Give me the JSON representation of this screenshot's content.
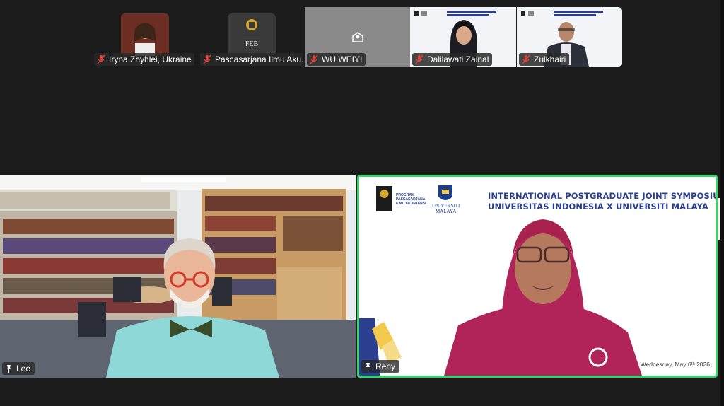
{
  "participants_strip": [
    {
      "name": "Iryna Zhyhlei, Ukraine",
      "muted": true,
      "avatar": "photo"
    },
    {
      "name": "Pascasarjana Ilmu Aku...",
      "muted": true,
      "avatar": "logo",
      "logo_text": "FEB"
    },
    {
      "name": "WU WEIYI",
      "muted": true,
      "avatar": "none"
    },
    {
      "name": "Dalilawati Zainal",
      "muted": true,
      "avatar": "video"
    },
    {
      "name": "Zulkhairi",
      "muted": true,
      "avatar": "video"
    }
  ],
  "main_speakers": [
    {
      "name": "Lee",
      "pinned": true,
      "active_speaker": false
    },
    {
      "name": "Reny",
      "pinned": true,
      "active_speaker": true
    }
  ],
  "slide": {
    "title_line1": "INTERNATIONAL POSTGRADUATE JOINT SYMPOSIUM",
    "title_line2": "UNIVERSITAS INDONESIA X UNIVERSITI MALAYA",
    "left_logo_line1": "PROGRAM",
    "left_logo_line2": "PASCASARJANA",
    "left_logo_line3": "ILMU AKUNTANSI",
    "right_logo_line1": "UNIVERSITI",
    "right_logo_line2": "MALAYA",
    "date": "Wednesday, May 6ᵗʰ 2026"
  },
  "colors": {
    "active_speaker_border": "#35d36a",
    "slide_title": "#2a3f8f",
    "mic_off": "#e0413a"
  }
}
